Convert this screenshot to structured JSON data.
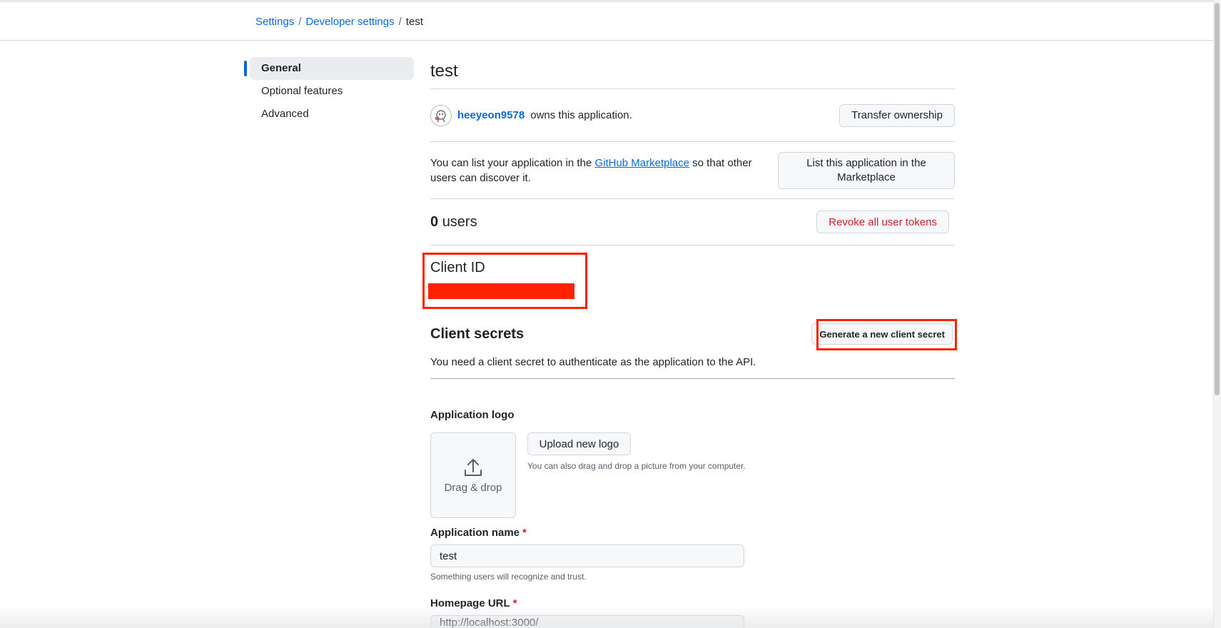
{
  "breadcrumb": {
    "settings": "Settings",
    "sep1": "/",
    "developer_settings": "Developer settings",
    "sep2": "/",
    "current": "test"
  },
  "sidebar": {
    "items": [
      {
        "label": "General",
        "active": true
      },
      {
        "label": "Optional features",
        "active": false
      },
      {
        "label": "Advanced",
        "active": false
      }
    ]
  },
  "app": {
    "title": "test",
    "owner": "heeyeon9578",
    "owner_suffix": "owns this application.",
    "transfer_label": "Transfer ownership"
  },
  "marketplace": {
    "text_before": "You can list your application in the",
    "link": "GitHub Marketplace",
    "text_after": "so that other users can discover it.",
    "button": "List this application in the Marketplace"
  },
  "users": {
    "count": "0",
    "label": "users",
    "revoke_label": "Revoke all user tokens"
  },
  "client_id": {
    "title": "Client ID"
  },
  "client_secrets": {
    "title": "Client secrets",
    "description": "You need a client secret to authenticate as the application to the API.",
    "generate_label": "Generate a new client secret"
  },
  "logo": {
    "label": "Application logo",
    "dropzone_text": "Drag & drop",
    "upload_label": "Upload new logo",
    "hint": "You can also drag and drop a picture from your computer."
  },
  "app_name": {
    "label": "Application name",
    "required_mark": "*",
    "value": "test",
    "hint": "Something users will recognize and trust."
  },
  "homepage": {
    "label": "Homepage URL",
    "required_mark": "*",
    "value": "http://localhost:3000/"
  },
  "colors": {
    "link": "#0969da",
    "danger": "#cf222e",
    "highlight": "#ff2200"
  }
}
